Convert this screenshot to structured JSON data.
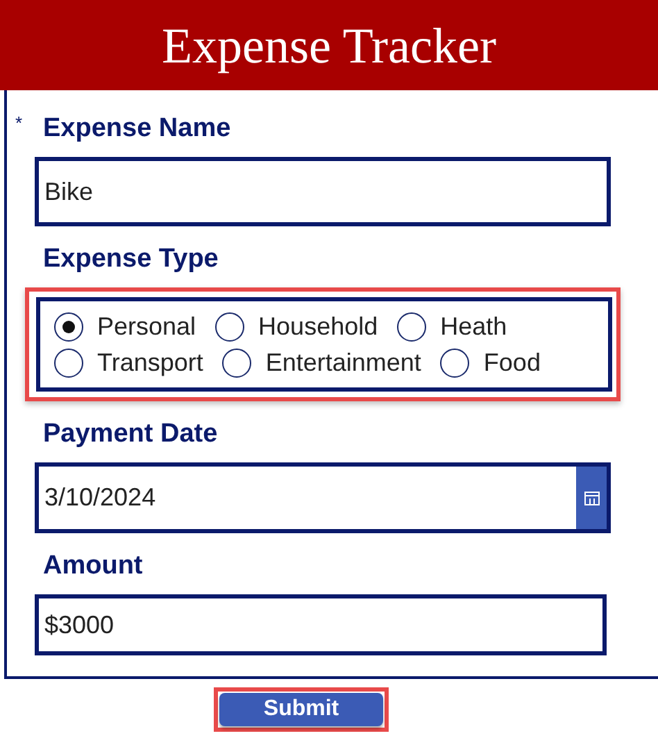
{
  "header": {
    "title": "Expense Tracker"
  },
  "fields": [
    {
      "kind": "text",
      "label": "Expense Name",
      "required_mark": "*",
      "value": "Bike"
    },
    {
      "kind": "radio",
      "label": "Expense Type",
      "highlighted": true,
      "options": [
        {
          "label": "Personal",
          "selected": true
        },
        {
          "label": "Household",
          "selected": false
        },
        {
          "label": "Heath",
          "selected": false
        },
        {
          "label": "Transport",
          "selected": false
        },
        {
          "label": "Entertainment",
          "selected": false
        },
        {
          "label": "Food",
          "selected": false
        }
      ]
    },
    {
      "kind": "date",
      "label": "Payment Date",
      "value": "3/10/2024"
    },
    {
      "kind": "text",
      "label": "Amount",
      "value": "$3000"
    }
  ],
  "submit": {
    "label": "Submit",
    "highlighted": true
  }
}
